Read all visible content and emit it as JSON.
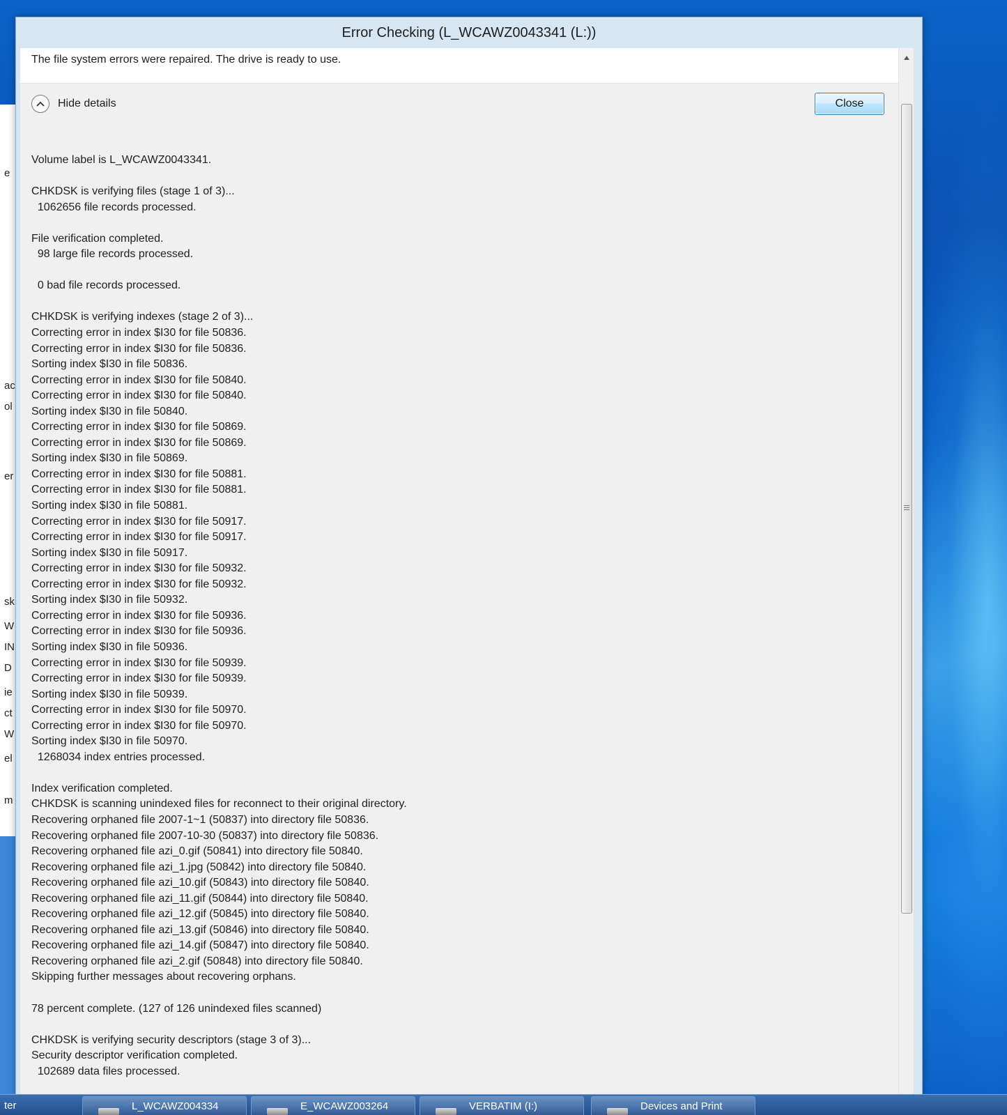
{
  "window": {
    "title": "Error Checking (L_WCAWZ0043341 (L:))"
  },
  "status_message": "The file system errors were repaired. The drive is ready to use.",
  "hide_details_label": "Hide details",
  "close_button_label": "Close",
  "log_lines": [
    "Volume label is L_WCAWZ0043341.",
    "",
    "CHKDSK is verifying files (stage 1 of 3)...",
    "  1062656 file records processed.",
    "",
    "File verification completed.",
    "  98 large file records processed.",
    "",
    "  0 bad file records processed.",
    "",
    "CHKDSK is verifying indexes (stage 2 of 3)...",
    "Correcting error in index $I30 for file 50836.",
    "Correcting error in index $I30 for file 50836.",
    "Sorting index $I30 in file 50836.",
    "Correcting error in index $I30 for file 50840.",
    "Correcting error in index $I30 for file 50840.",
    "Sorting index $I30 in file 50840.",
    "Correcting error in index $I30 for file 50869.",
    "Correcting error in index $I30 for file 50869.",
    "Sorting index $I30 in file 50869.",
    "Correcting error in index $I30 for file 50881.",
    "Correcting error in index $I30 for file 50881.",
    "Sorting index $I30 in file 50881.",
    "Correcting error in index $I30 for file 50917.",
    "Correcting error in index $I30 for file 50917.",
    "Sorting index $I30 in file 50917.",
    "Correcting error in index $I30 for file 50932.",
    "Correcting error in index $I30 for file 50932.",
    "Sorting index $I30 in file 50932.",
    "Correcting error in index $I30 for file 50936.",
    "Correcting error in index $I30 for file 50936.",
    "Sorting index $I30 in file 50936.",
    "Correcting error in index $I30 for file 50939.",
    "Correcting error in index $I30 for file 50939.",
    "Sorting index $I30 in file 50939.",
    "Correcting error in index $I30 for file 50970.",
    "Correcting error in index $I30 for file 50970.",
    "Sorting index $I30 in file 50970.",
    "  1268034 index entries processed.",
    "",
    "Index verification completed.",
    "CHKDSK is scanning unindexed files for reconnect to their original directory.",
    "Recovering orphaned file 2007-1~1 (50837) into directory file 50836.",
    "Recovering orphaned file 2007-10-30 (50837) into directory file 50836.",
    "Recovering orphaned file azi_0.gif (50841) into directory file 50840.",
    "Recovering orphaned file azi_1.jpg (50842) into directory file 50840.",
    "Recovering orphaned file azi_10.gif (50843) into directory file 50840.",
    "Recovering orphaned file azi_11.gif (50844) into directory file 50840.",
    "Recovering orphaned file azi_12.gif (50845) into directory file 50840.",
    "Recovering orphaned file azi_13.gif (50846) into directory file 50840.",
    "Recovering orphaned file azi_14.gif (50847) into directory file 50840.",
    "Recovering orphaned file azi_2.gif (50848) into directory file 50840.",
    "Skipping further messages about recovering orphans.",
    "",
    "78 percent complete. (127 of 126 unindexed files scanned)",
    "",
    "CHKDSK is verifying security descriptors (stage 3 of 3)...",
    "Security descriptor verification completed.",
    "  102689 data files processed."
  ],
  "background_fragments": [
    "e",
    "ac",
    "ol",
    "er",
    "sk",
    "W",
    "IN",
    "D",
    "ie",
    "ct",
    "W",
    "el",
    "m"
  ],
  "taskbar": {
    "left_text": "ter",
    "items": [
      "L_WCAWZ004334",
      "E_WCAWZ003264",
      "VERBATIM (I:)",
      "Devices and Print"
    ]
  },
  "icons": {
    "collapse": "chevron-up-icon",
    "scroll_up": "triangle-up-icon",
    "drive": "drive-icon",
    "printer": "printer-icon"
  },
  "colors": {
    "dialog_frame": "#d6e6f3",
    "close_button_border": "#3c7fb1",
    "desktop": "#0b63c6"
  }
}
